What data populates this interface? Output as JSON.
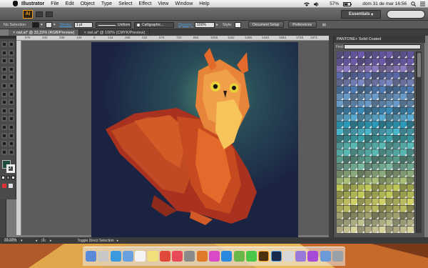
{
  "menubar": {
    "app_name": "Illustrator",
    "items": [
      "File",
      "Edit",
      "Object",
      "Type",
      "Select",
      "Effect",
      "View",
      "Window",
      "Help"
    ],
    "battery": "57%",
    "clock": "dom 31 de mar  16:56"
  },
  "appbar": {
    "logo": "Ai",
    "workspace": "Essentials"
  },
  "control": {
    "selection": "No Selection",
    "stroke_label": "Stroke:",
    "stroke_value": "1 pt",
    "profile": "Uniform",
    "brush": "Calligraphic...",
    "opacity_label": "Opacity:",
    "opacity_value": "100%",
    "style_label": "Style:",
    "doc_setup": "Document Setup",
    "preferences": "Preferences"
  },
  "tabs": [
    {
      "label": "owl.ai* @ 33,33% (RGB/Preview)",
      "active": true
    },
    {
      "label": "owl.ai* @ 100% (CMYK/Preview)",
      "active": false
    }
  ],
  "ruler": {
    "ticks": [
      "576",
      "432",
      "288",
      "144",
      "0",
      "144",
      "288",
      "432",
      "576",
      "720",
      "864",
      "1008",
      "1152",
      "1296",
      "1440",
      "1584",
      "1728",
      "1872",
      "2016"
    ]
  },
  "panel": {
    "title": "PANTONE+ Solid Coated",
    "find_label": "Find:"
  },
  "status": {
    "zoom": "33,33%",
    "page": "1",
    "message": "Toggle Direct Selection"
  },
  "tools": [
    "selection-tool",
    "direct-selection-tool",
    "magic-wand-tool",
    "lasso-tool",
    "pen-tool",
    "type-tool",
    "line-tool",
    "rectangle-tool",
    "paintbrush-tool",
    "pencil-tool",
    "blob-brush-tool",
    "eraser-tool",
    "rotate-tool",
    "scale-tool",
    "width-tool",
    "free-transform-tool",
    "shape-builder-tool",
    "perspective-tool",
    "mesh-tool",
    "gradient-tool",
    "eyedropper-tool",
    "blend-tool",
    "symbol-sprayer-tool",
    "graph-tool",
    "artboard-tool",
    "slice-tool",
    "hand-tool",
    "zoom-tool"
  ],
  "dock_apps": [
    "finder",
    "launchpad",
    "safari",
    "mail",
    "calendar",
    "notes",
    "chrome",
    "pocket",
    "sound",
    "firefox",
    "itunes",
    "skype",
    "evernote",
    "messages",
    "illustrator",
    "photoshop",
    "textedit",
    "photos",
    "itunes-2",
    "finder-2",
    "trash"
  ],
  "colors": {
    "accent": "#f39a12",
    "artboard": "#1a2342",
    "link": "#4f9fe6"
  }
}
